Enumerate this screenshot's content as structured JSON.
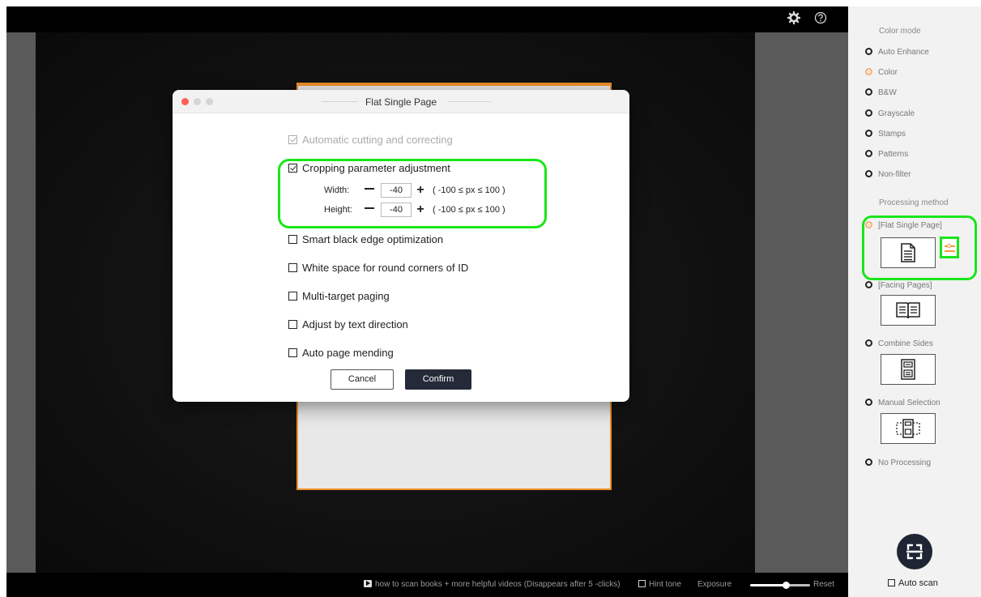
{
  "topbar": {
    "settings_icon": "gear-icon",
    "help_icon": "help-icon"
  },
  "bottombar": {
    "tip": "how to scan books + more helpful videos (Disappears after 5 -clicks)",
    "hint_tone": "Hint tone",
    "exposure": "Exposure",
    "exposure_level": 0.6,
    "reset": "Reset"
  },
  "panel": {
    "color_mode_title": "Color mode",
    "color_modes": [
      "Auto Enhance",
      "Color",
      "B&W",
      "Grayscale",
      "Stamps",
      "Patterns",
      "Non-filter"
    ],
    "selected_color_mode": "Color",
    "processing_title": "Processing method",
    "methods": [
      "[Flat Single Page]",
      "[Facing Pages]",
      "Combine Sides",
      "Manual Selection",
      "No Processing"
    ],
    "selected_method": "[Flat Single Page]",
    "auto_scan": "Auto scan"
  },
  "dialog": {
    "title": "Flat Single Page",
    "options": {
      "auto_cut": "Automatic cutting and correcting",
      "crop_adjust": "Cropping parameter adjustment",
      "smart_edge": "Smart black edge optimization",
      "white_space": "White space for round corners of ID",
      "multi_target": "Multi-target paging",
      "text_direction": "Adjust by text direction",
      "page_mending": "Auto page mending"
    },
    "width_label": "Width:",
    "width_value": "-40",
    "height_label": "Height:",
    "height_value": "-40",
    "range": "( -100 ≤ px ≤ 100 )",
    "cancel": "Cancel",
    "confirm": "Confirm"
  },
  "colors": {
    "highlight": "#19e619",
    "accent": "#f0902a",
    "primary_button": "#242a38"
  }
}
